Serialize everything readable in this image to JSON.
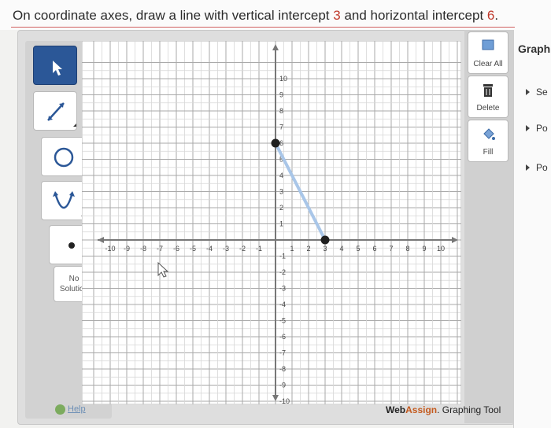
{
  "question": {
    "prefix": "On coordinate axes, draw a line with vertical intercept ",
    "vertical_intercept": "3",
    "middle": " and horizontal intercept ",
    "horizontal_intercept": "6",
    "suffix": "."
  },
  "tools": [
    "pointer-tool",
    "line-tool",
    "circle-tool",
    "parabola-tool",
    "point-tool"
  ],
  "no_solution_label_1": "No",
  "no_solution_label_2": "Solution",
  "help_label": "Help",
  "right_buttons": {
    "clear_all": "Clear All",
    "delete": "Delete",
    "fill": "Fill"
  },
  "brand": {
    "web": "Web",
    "assign": "Assign",
    "tail": ". Graphing Tool"
  },
  "side_panel": {
    "title": "Graph",
    "items": [
      "Se",
      "Po",
      "Po"
    ]
  },
  "graph": {
    "x_range": [
      -10,
      10
    ],
    "y_range": [
      -10,
      10
    ],
    "x_ticks": [
      "-10",
      "-9",
      "-8",
      "-7",
      "-6",
      "-5",
      "-4",
      "-3",
      "-2",
      "-1",
      "1",
      "2",
      "3",
      "4",
      "5",
      "6",
      "7",
      "8",
      "9",
      "10"
    ],
    "y_ticks": [
      "10",
      "9",
      "8",
      "7",
      "6",
      "5",
      "4",
      "3",
      "2",
      "1",
      "-1",
      "-2",
      "-3",
      "-4",
      "-5",
      "-6",
      "-7",
      "-8",
      "-9",
      "-10"
    ],
    "plotted_points": [
      {
        "x": 0,
        "y": 6
      },
      {
        "x": 3,
        "y": 0
      }
    ],
    "line_color": "#a9c6e8",
    "point_color": "#1f1f1f"
  }
}
